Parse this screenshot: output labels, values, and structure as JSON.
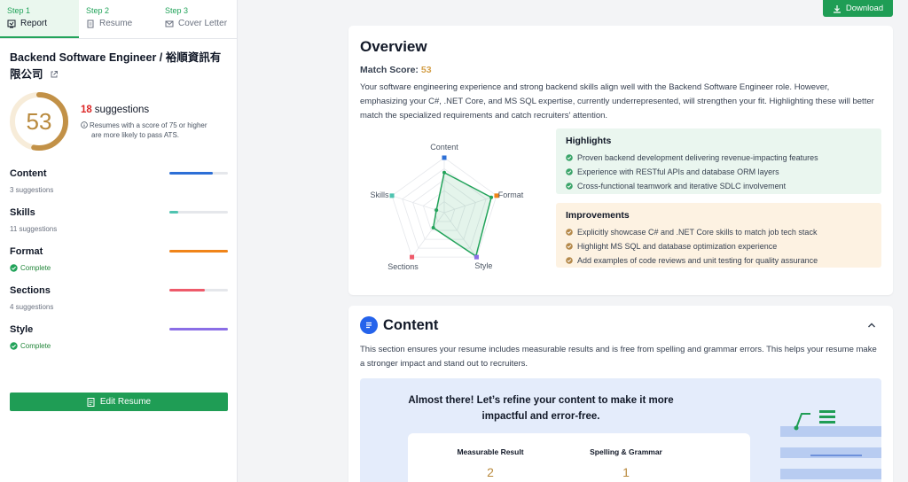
{
  "steps": [
    {
      "num": "Step 1",
      "label": "Report"
    },
    {
      "num": "Step 2",
      "label": "Resume"
    },
    {
      "num": "Step 3",
      "label": "Cover Letter"
    }
  ],
  "job_title": "Backend Software Engineer / 裕順資訊有限公司",
  "score": {
    "value": "53",
    "fraction": 0.53
  },
  "suggestions": {
    "count": "18",
    "label": "suggestions"
  },
  "ats_note": {
    "line1": "Resumes with a score of 75 or higher",
    "line2": "are more likely to pass ATS."
  },
  "categories": [
    {
      "name": "Content",
      "status": "3 suggestions",
      "complete": false,
      "progress": 0.74,
      "color": "#2d6fd6"
    },
    {
      "name": "Skills",
      "status": "11 suggestions",
      "complete": false,
      "progress": 0.15,
      "color": "#4fc3b0"
    },
    {
      "name": "Format",
      "status": "Complete",
      "complete": true,
      "progress": 1.0,
      "color": "#f08419"
    },
    {
      "name": "Sections",
      "status": "4 suggestions",
      "complete": false,
      "progress": 0.6,
      "color": "#ee5a6a"
    },
    {
      "name": "Style",
      "status": "Complete",
      "complete": true,
      "progress": 1.0,
      "color": "#8b6ee6"
    }
  ],
  "edit_button": "Edit Resume",
  "download_button": "Download",
  "overview": {
    "title": "Overview",
    "match_label": "Match Score:",
    "match_value": "53",
    "description": "Your software engineering experience and strong backend skills align well with the Backend Software Engineer role. However, emphasizing your C#, .NET Core, and MS SQL expertise, currently underrepresented, will strengthen your fit. Highlighting these will better match the specialized requirements and catch recruiters' attention.",
    "radar": {
      "axes": [
        "Content",
        "Format",
        "Style",
        "Sections",
        "Skills"
      ],
      "values": [
        0.73,
        0.9,
        0.98,
        0.34,
        0.15
      ],
      "axis_colors": [
        "#2d6fd6",
        "#f08419",
        "#8b6ee6",
        "#ee5a6a",
        "#4fc3b0"
      ]
    },
    "highlights": {
      "title": "Highlights",
      "items": [
        "Proven backend development delivering revenue-impacting features",
        "Experience with RESTful APIs and database ORM layers",
        "Cross-functional teamwork and iterative SDLC involvement"
      ]
    },
    "improvements": {
      "title": "Improvements",
      "items": [
        "Explicitly showcase C# and .NET Core skills to match job tech stack",
        "Highlight MS SQL and database optimization experience",
        "Add examples of code reviews and unit testing for quality assurance"
      ]
    }
  },
  "content": {
    "title": "Content",
    "description": "This section ensures your resume includes measurable results and is free from spelling and grammar errors. This helps your resume make a stronger impact and stand out to recruiters.",
    "promo_title": "Almost there! Let’s refine your content to make it more impactful and error-free.",
    "metrics": [
      {
        "label": "Measurable Result",
        "value": "2"
      },
      {
        "label": "Spelling & Grammar",
        "value": "1"
      }
    ]
  }
}
